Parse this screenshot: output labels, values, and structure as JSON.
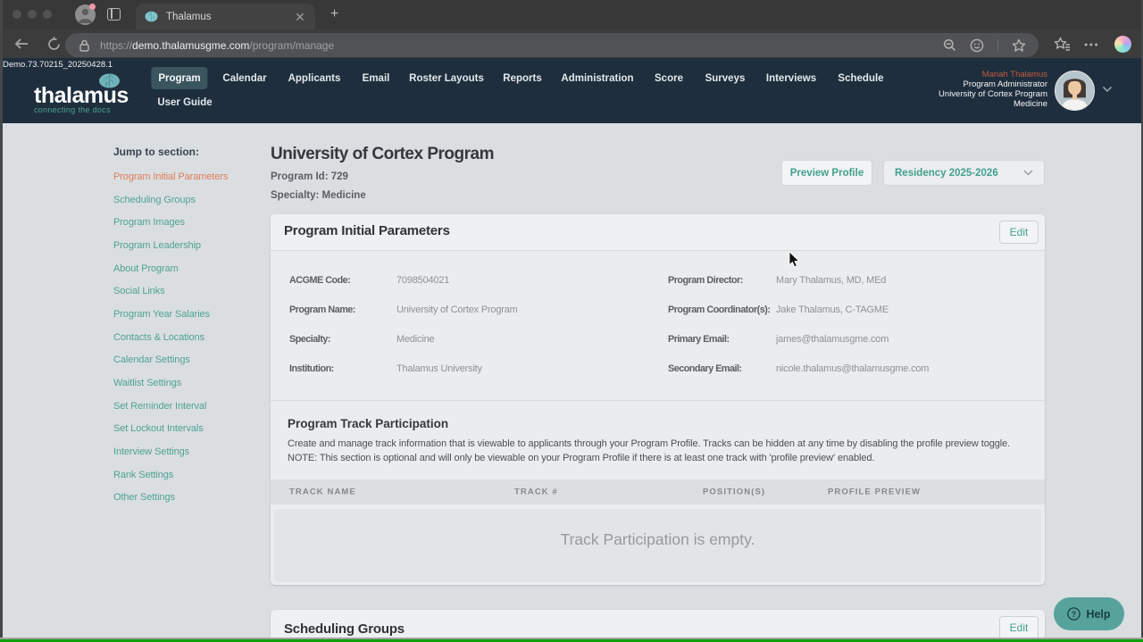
{
  "build_tag": "Demo.73.70215_20250428.1",
  "browser": {
    "tab_title": "Thalamus",
    "url_prefix": "https://",
    "url_domain": "demo.thalamusgme.com",
    "url_path": "/program/manage"
  },
  "logo": {
    "name": "thalamus",
    "tagline": "connecting the docs"
  },
  "nav": {
    "items": [
      "Program",
      "Calendar",
      "Applicants",
      "Email",
      "Roster Layouts",
      "Reports",
      "Administration",
      "Score",
      "Surveys",
      "Interviews",
      "Schedule"
    ],
    "active": "Program",
    "row2": [
      "User Guide"
    ]
  },
  "user": {
    "name": "Mariah Thalamus",
    "role": "Program Administrator",
    "program": "University of Cortex Program",
    "specialty": "Medicine"
  },
  "sidebar": {
    "heading": "Jump to section:",
    "items": [
      "Program Initial Parameters",
      "Scheduling Groups",
      "Program Images",
      "Program Leadership",
      "About Program",
      "Social Links",
      "Program Year Salaries",
      "Contacts & Locations",
      "Calendar Settings",
      "Waitlist Settings",
      "Set Reminder Interval",
      "Set Lockout Intervals",
      "Interview Settings",
      "Rank Settings",
      "Other Settings"
    ],
    "active_index": 0
  },
  "page": {
    "title": "University of Cortex Program",
    "program_id_label": "Program Id: 729",
    "specialty_label": "Specialty: Medicine",
    "preview_button": "Preview Profile",
    "season_select": "Residency 2025-2026"
  },
  "initial_params": {
    "title": "Program Initial Parameters",
    "edit_label": "Edit",
    "fields_left": [
      {
        "label": "ACGME Code:",
        "value": "7098504021"
      },
      {
        "label": "Program Name:",
        "value": "University of Cortex Program"
      },
      {
        "label": "Specialty:",
        "value": "Medicine"
      },
      {
        "label": "Institution:",
        "value": "Thalamus University"
      }
    ],
    "fields_right": [
      {
        "label": "Program Director:",
        "value": "Mary Thalamus, MD, MEd"
      },
      {
        "label": "Program Coordinator(s):",
        "value": "Jake Thalamus, C-TAGME"
      },
      {
        "label": "Primary Email:",
        "value": "james@thalamusgme.com"
      },
      {
        "label": "Secondary Email:",
        "value": "nicole.thalamus@thalamusgme.com"
      }
    ]
  },
  "track_participation": {
    "title": "Program Track Participation",
    "description_line1": "Create and manage track information that is viewable to applicants through your Program Profile. Tracks can be hidden at any time by disabling the profile preview toggle.",
    "description_line2": "NOTE: This section is optional and will only be viewable on your Program Profile if there is at least one track with 'profile preview' enabled.",
    "columns": [
      "TRACK NAME",
      "TRACK #",
      "POSITION(S)",
      "PROFILE PREVIEW"
    ],
    "empty_message": "Track Participation is empty."
  },
  "scheduling_groups": {
    "title": "Scheduling Groups",
    "edit_label": "Edit"
  },
  "help": {
    "label": "Help"
  }
}
